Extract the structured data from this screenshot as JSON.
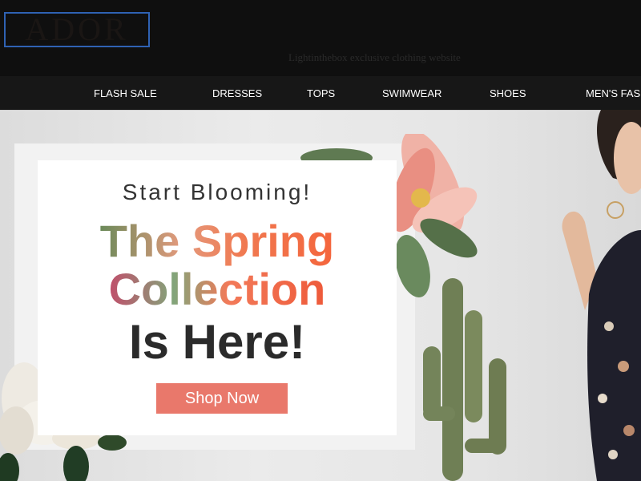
{
  "header": {
    "logo": "ADOR",
    "tagline": "Lightinthebox exclusive clothing website"
  },
  "nav": {
    "items": [
      {
        "label": "FLASH SALE"
      },
      {
        "label": "DRESSES"
      },
      {
        "label": "TOPS"
      },
      {
        "label": "SWIMWEAR"
      },
      {
        "label": "SHOES"
      },
      {
        "label": "MEN'S FASHION"
      }
    ]
  },
  "hero": {
    "kicker": "Start Blooming!",
    "headline_line1": "The Spring",
    "headline_line2": "Collection",
    "headline_line3": "Is Here!",
    "cta": "Shop Now"
  },
  "colors": {
    "header_bg": "#0f0f0f",
    "nav_bg": "#171717",
    "logo_border": "#2f62b3",
    "cta_bg": "#e9786b"
  }
}
